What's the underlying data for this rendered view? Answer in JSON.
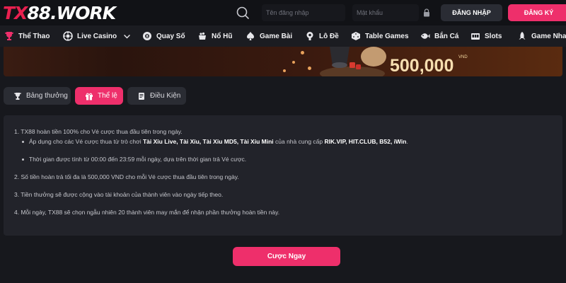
{
  "header": {
    "logo_tx": "TX",
    "logo_rest": "88.WORK",
    "username_placeholder": "Tên đăng nhập",
    "password_placeholder": "Mật khẩu",
    "login_label": "ĐĂNG NHẬP",
    "register_label": "ĐĂNG KÝ",
    "icons": [
      "search-icon",
      "lock-icon"
    ]
  },
  "nav": {
    "items": [
      {
        "label": "Thể Thao",
        "icon": "trophy-icon"
      },
      {
        "label": "Live Casino",
        "icon": "casino-chip-icon"
      },
      {
        "label": "Quay Số",
        "icon": "lottery-ball-icon"
      },
      {
        "label": "Nổ Hũ",
        "icon": "jackpot-pot-icon"
      },
      {
        "label": "Game Bài",
        "icon": "cards-icon"
      },
      {
        "label": "Lô Đề",
        "icon": "lottery-icon"
      },
      {
        "label": "Table Games",
        "icon": "dice-icon"
      },
      {
        "label": "Bắn Cá",
        "icon": "fish-icon"
      },
      {
        "label": "Slots",
        "icon": "slot-machine-icon"
      },
      {
        "label": "Game Nhanh",
        "icon": "rocket-icon"
      }
    ]
  },
  "banner": {
    "currency": "VND",
    "amount": "500,000"
  },
  "tabs": [
    {
      "label": "Bảng thưởng",
      "icon": "trophy-icon"
    },
    {
      "label": "Thể lệ",
      "icon": "gift-icon"
    },
    {
      "label": "Điều Kiện",
      "icon": "document-icon"
    }
  ],
  "rules": {
    "r1": "1. TX88 hoàn tiền 100% cho Vé cược thua đầu tiên trong ngày.",
    "r1a_pre": "Áp dụng cho các Vé cược thua từ trò chơi ",
    "r1a_games": "Tài Xỉu Live, Tài Xỉu, Tài Xỉu MD5, Tài Xỉu Mini",
    "r1a_mid": " của nhà cung cấp ",
    "r1a_providers": "RIK.VIP, HIT.CLUB, B52, iWin",
    "r1a_end": ".",
    "r1b": "Thời gian được tính từ 00:00 đến 23:59 mỗi ngày, dựa trên thời gian trả Vé cược.",
    "r2": "2. Số tiền hoàn trả tối đa là 500,000 VND cho mỗi Vé cược thua đầu tiên trong ngày.",
    "r3": "3. Tiền thưởng sẽ được cộng vào tài khoản của thành viên vào ngày tiếp theo.",
    "r4": "4. Mỗi ngày, TX88 sẽ chọn ngẫu nhiên 20 thành viên may mắn để nhận phần thưởng hoàn tiền này."
  },
  "cta_label": "Cược Ngay",
  "colors": {
    "accent": "#ee2f6b",
    "background": "#17181d",
    "panel": "#22232a"
  }
}
